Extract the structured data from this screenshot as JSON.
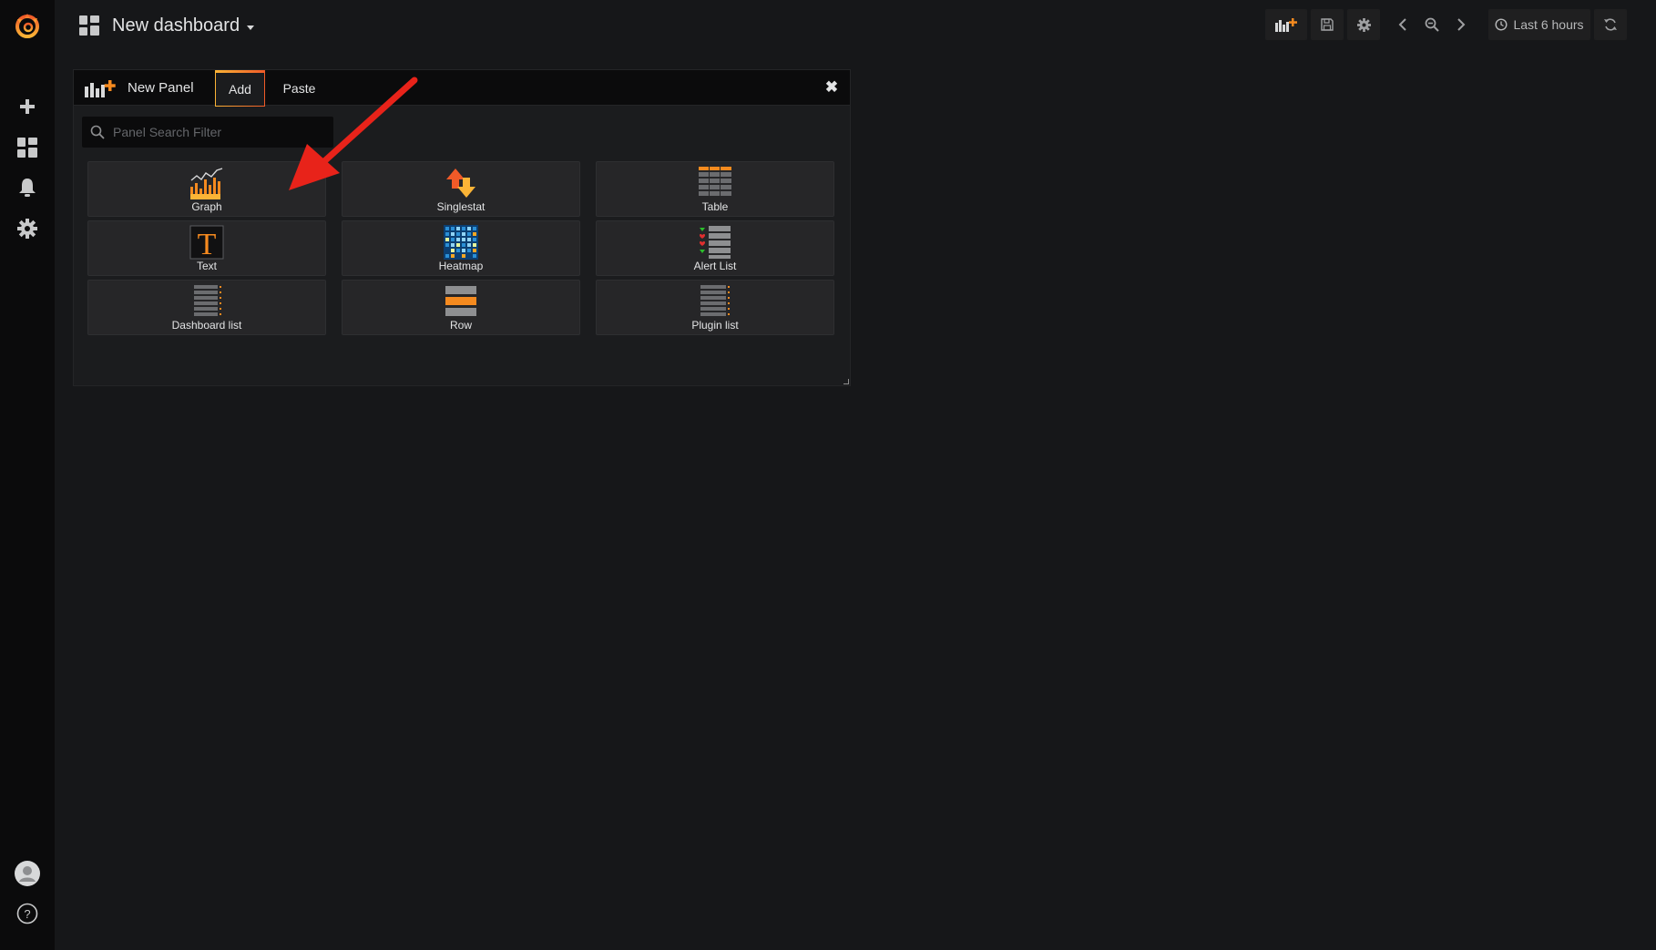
{
  "header": {
    "dashboard_title": "New dashboard",
    "time_range": "Last 6 hours"
  },
  "sidebar": {
    "items": [
      {
        "name": "create",
        "icon": "plus-icon"
      },
      {
        "name": "dashboards",
        "icon": "apps-icon"
      },
      {
        "name": "alerting",
        "icon": "bell-icon"
      },
      {
        "name": "configuration",
        "icon": "gear-icon"
      }
    ],
    "bottom": [
      {
        "name": "profile",
        "icon": "avatar-icon"
      },
      {
        "name": "help",
        "icon": "question-icon"
      }
    ]
  },
  "add_panel": {
    "title": "New Panel",
    "tabs": [
      {
        "label": "Add",
        "active": true
      },
      {
        "label": "Paste",
        "active": false
      }
    ],
    "search_placeholder": "Panel Search Filter",
    "panels": [
      {
        "label": "Graph",
        "icon": "graph-icon"
      },
      {
        "label": "Singlestat",
        "icon": "singlestat-icon"
      },
      {
        "label": "Table",
        "icon": "table-icon"
      },
      {
        "label": "Text",
        "icon": "text-icon"
      },
      {
        "label": "Heatmap",
        "icon": "heatmap-icon"
      },
      {
        "label": "Alert List",
        "icon": "alert-list-icon"
      },
      {
        "label": "Dashboard list",
        "icon": "dashboard-list-icon"
      },
      {
        "label": "Row",
        "icon": "row-icon"
      },
      {
        "label": "Plugin list",
        "icon": "plugin-list-icon"
      }
    ]
  },
  "colors": {
    "accent_orange": "#f58a1f",
    "accent_yellow": "#fbb436",
    "annotation_arrow": "#e8231a",
    "background": "#161719",
    "sidebar": "#0b0b0c"
  }
}
